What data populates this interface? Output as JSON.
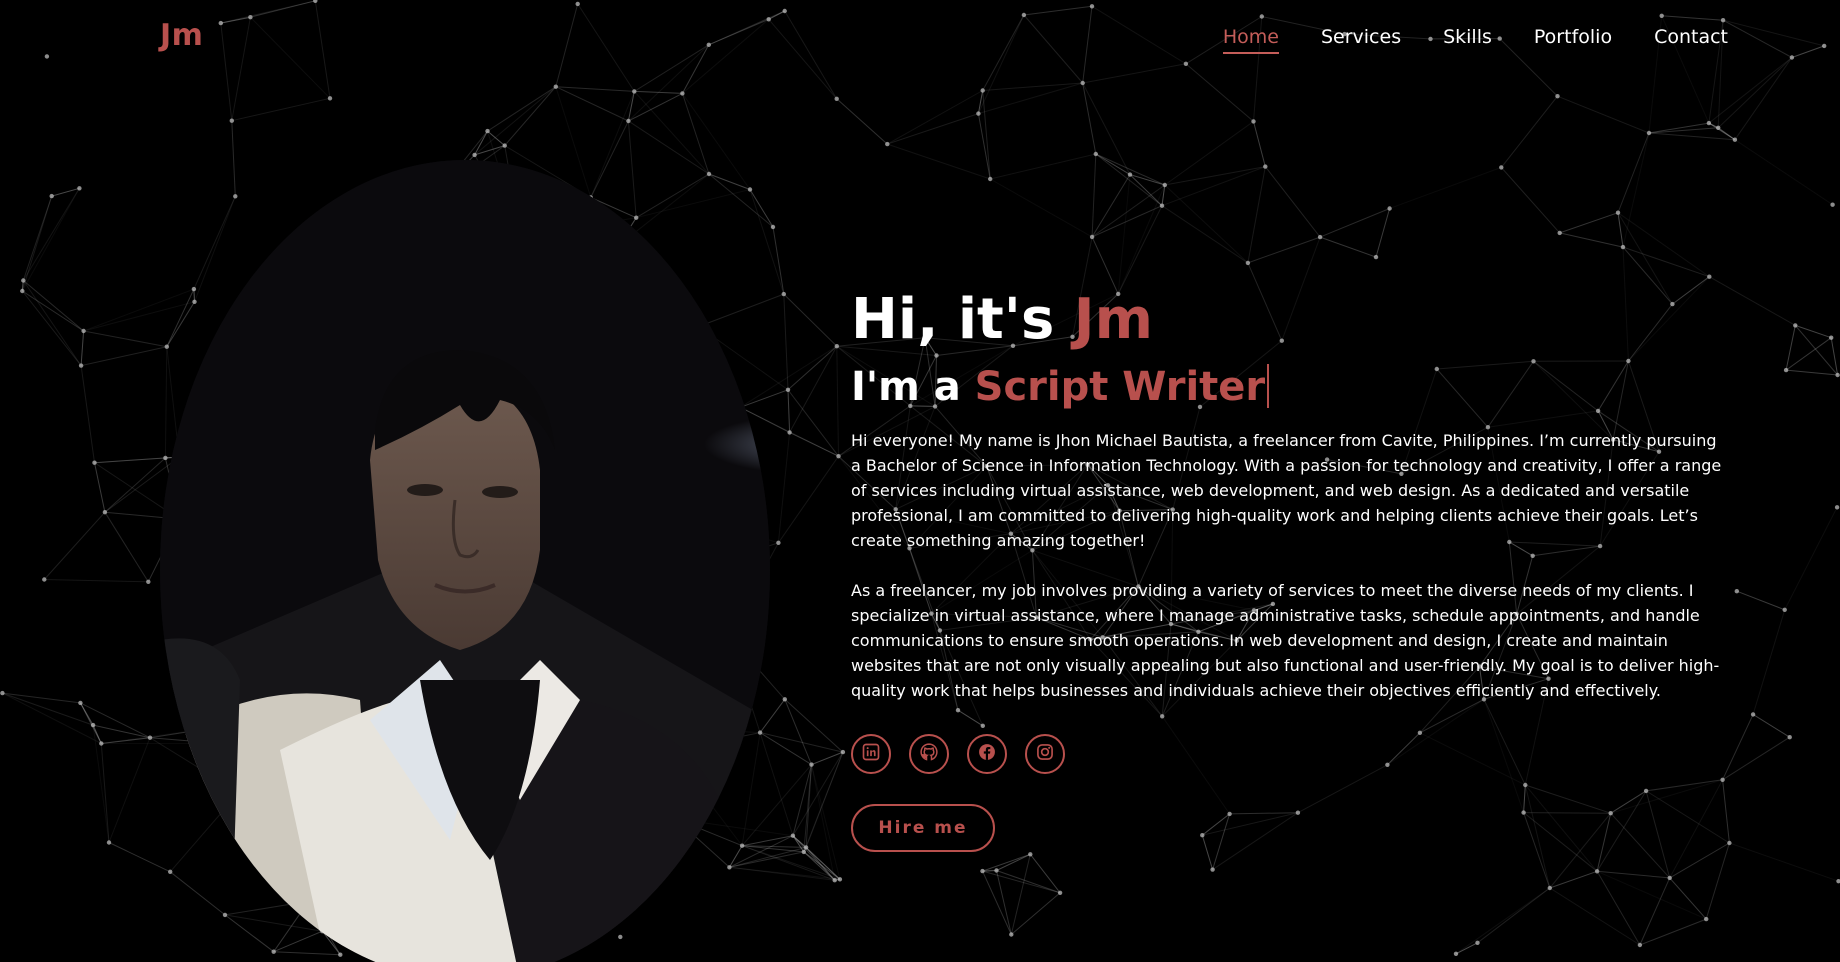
{
  "brand": {
    "logo": "Jm"
  },
  "nav": {
    "items": [
      {
        "label": "Home",
        "active": true
      },
      {
        "label": "Services",
        "active": false
      },
      {
        "label": "Skills",
        "active": false
      },
      {
        "label": "Portfolio",
        "active": false
      },
      {
        "label": "Contact",
        "active": false
      }
    ]
  },
  "hero": {
    "greeting": "Hi, it's ",
    "name": "Jm",
    "role_prefix": "I'm a ",
    "role": "Script Writer",
    "paragraphs": [
      "Hi everyone! My name is Jhon Michael Bautista, a freelancer from Cavite, Philippines. I’m currently pursuing a Bachelor of Science in Information Technology. With a passion for technology and creativity, I offer a range of services including virtual assistance, web development, and web design. As a dedicated and versatile professional, I am committed to delivering high-quality work and helping clients achieve their goals. Let’s create something amazing together!",
      "As a freelancer, my job involves providing a variety of services to meet the diverse needs of my clients. I specialize in virtual assistance, where I manage administrative tasks, schedule appointments, and handle communications to ensure smooth operations. In web development and design, I create and maintain websites that are not only visually appealing but also functional and user-friendly. My goal is to deliver high-quality work that helps businesses and individuals achieve their objectives efficiently and effectively."
    ],
    "socials": [
      {
        "icon": "linkedin-icon"
      },
      {
        "icon": "github-icon"
      },
      {
        "icon": "facebook-icon"
      },
      {
        "icon": "instagram-icon"
      }
    ],
    "cta": "Hire me"
  },
  "colors": {
    "background": "#000000",
    "accent": "#b8504d",
    "text": "#ffffff",
    "network": "#bbbbbb"
  }
}
